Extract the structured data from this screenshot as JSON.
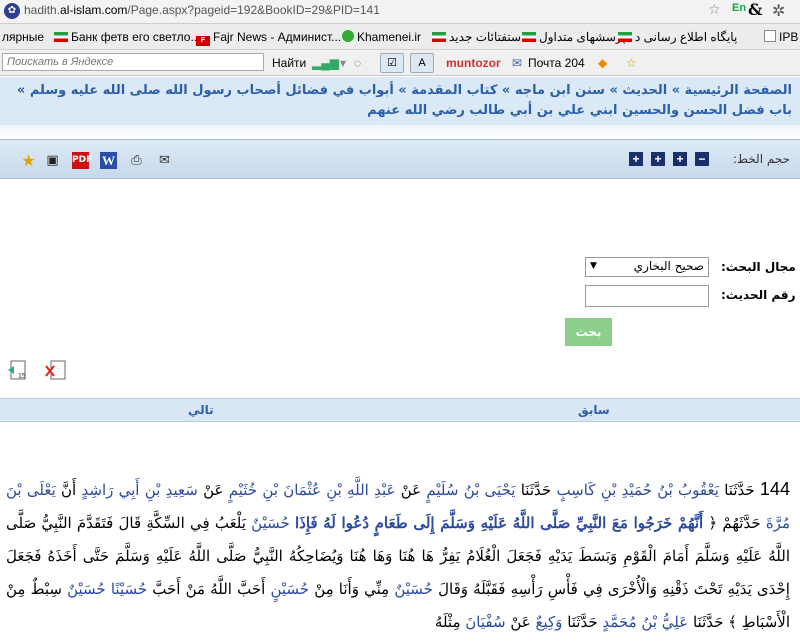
{
  "browser": {
    "url_prefix": "hadith.",
    "url_domain": "al-islam.com",
    "url_rest": "/Page.aspx?pageid=192&BookID=29&PID=141",
    "lang": "En"
  },
  "bookmarks": [
    {
      "label": "лярные",
      "flag": "none"
    },
    {
      "label": "Банк фетв его светло...",
      "flag": "ir"
    },
    {
      "label": "Fajr News - Админист...",
      "flag": "red"
    },
    {
      "label": "Khamenei.ir",
      "flag": "kh"
    },
    {
      "label": "استفتائات جدید",
      "flag": "ir"
    },
    {
      "label": "پرسشهای متداول",
      "flag": "ir"
    },
    {
      "label": "پایگاه اطلاع رسانی د",
      "flag": "ir"
    },
    {
      "label": "IPB",
      "flag": "doc"
    }
  ],
  "yandex": {
    "placeholder": "Поискать в Яндексе",
    "find": "Найти",
    "muntozor": "muntozor",
    "mail": "Почта 204"
  },
  "breadcrumb": "الصفحة الرئيسية » الحديث » سنن ابن ماجه » كتاب المقدمة » أبواب في فضائل أصحاب رسول الله صلى الله عليه وسلم » باب فضل الحسن والحسين ابني علي بن أبي طالب رضي الله عنهم",
  "toolbar": {
    "font_size_label": "حجم الخط:",
    "minus": "−",
    "plus": "+"
  },
  "search": {
    "field_label": "مجال البحث:",
    "field_value": "صحيح البخاري",
    "number_label": "رقم الحديث:",
    "button": "بحث"
  },
  "nav": {
    "previous": "سابق",
    "next": "تالي"
  },
  "hadith": {
    "number": "144",
    "p1": "حَدَّثَنَا",
    "n1": "يَعْقُوبُ بْنُ حُمَيْدِ بْنِ كَاسِبٍ",
    "p2": "حَدَّثَنَا",
    "n2": "يَحْيَى بْنُ سُلَيْمٍ",
    "p3": "عَنْ",
    "n3": "عَبْدِ اللَّهِ بْنِ عُثْمَانَ بْنِ خُثَيْمٍ",
    "p4": "عَنْ",
    "n4": "سَعِيدِ بْنِ أَبِي رَاشِدٍ",
    "p5": "أَنَّ",
    "n5": "يَعْلَى بْنَ مُرَّةَ",
    "p6": "حَدَّثَهُمْ ﴿",
    "q1": "أَنَّهُمْ خَرَجُوا مَعَ النَّبِيِّ صَلَّى اللَّهُ عَلَيْهِ وَسَلَّمَ إِلَى طَعَامٍ دُعُوا لَهُ فَإِذَا",
    "n6": "حُسَيْنٌ",
    "p7": "يَلْعَبُ فِي السِّكَّةِ قَالَ فَتَقَدَّمَ النَّبِيُّ صَلَّى اللَّهُ عَلَيْهِ وَسَلَّمَ أَمَامَ الْقَوْمِ وَبَسَطَ يَدَيْهِ فَجَعَلَ الْغُلَامُ يَفِرُّ هَا هُنَا وَهَا هُنَا وَيُضَاحِكُهُ النَّبِيُّ صَلَّى اللَّهُ عَلَيْهِ وَسَلَّمَ حَتَّى أَخَذَهُ فَجَعَلَ إِحْدَى يَدَيْهِ تَحْتَ ذَقْنِهِ وَالْأُخْرَى فِي فَأْسِ رَأْسِهِ فَقَبَّلَهُ وَقَالَ",
    "n7": "حُسَيْنٌ",
    "p8": "مِنِّي وَأَنَا مِنْ",
    "n8": "حُسَيْنٍ",
    "p9": "أَحَبَّ اللَّهُ مَنْ أَحَبَّ",
    "n9": "حُسَيْنًا حُسَيْنٌ",
    "p10": "سِبْطٌ مِنْ الْأَسْبَاطِ ﴾ حَدَّثَنَا",
    "n10": "عَلِيُّ بْنُ مُحَمَّدٍ",
    "p11": "حَدَّثَنَا",
    "n11": "وَكِيعٌ",
    "p12": "عَنْ",
    "n12": "سُفْيَانَ",
    "p13": "مِثْلَهُ"
  },
  "colors": {
    "link_blue": "#2b5fa8",
    "crumb_bg": "#dbe9f7",
    "button_green": "#8ccf8c"
  }
}
